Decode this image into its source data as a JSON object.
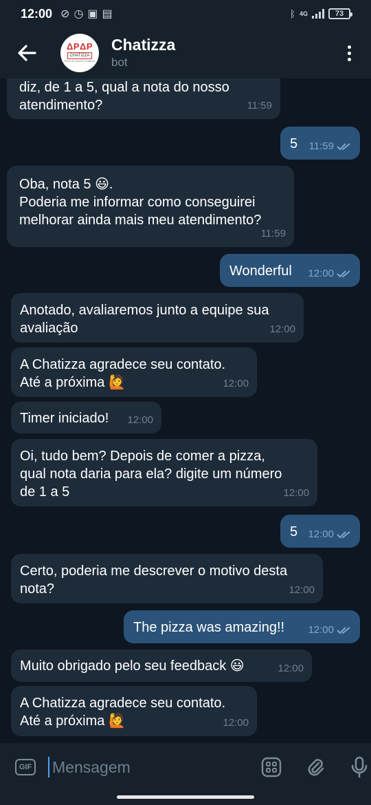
{
  "status_bar": {
    "time": "12:00",
    "network": "4G",
    "battery": "73"
  },
  "header": {
    "title": "Chatizza",
    "subtitle": "bot",
    "avatar_logo_top": "ΔPΔP",
    "avatar_logo_name": "CHATIZZA",
    "avatar_logo_sub": "Pizza & Lanche Chatizza"
  },
  "messages": [
    {
      "dir": "in",
      "text": "diz, de 1 a 5, qual a nota do nosso\natendimento?",
      "time": "11:59"
    },
    {
      "dir": "out",
      "text": "5",
      "time": "11:59"
    },
    {
      "dir": "in",
      "text": "Oba, nota 5 😃.\nPoderia me informar como conseguirei\nmelhorar ainda mais meu atendimento?",
      "time": "11:59"
    },
    {
      "dir": "out",
      "text": "Wonderful",
      "time": "12:00"
    },
    {
      "dir": "in",
      "text": "Anotado, avaliaremos junto a equipe sua\navaliação",
      "time": "12:00"
    },
    {
      "dir": "in",
      "text": "A Chatizza agradece seu contato.\nAté a próxima 🙋",
      "time": "12:00"
    },
    {
      "dir": "in",
      "text": "Timer iniciado!",
      "time": "12:00"
    },
    {
      "dir": "in",
      "text": "Oi, tudo bem? Depois de comer a pizza,\nqual nota daria para ela? digite um número\nde 1 a 5",
      "time": "12:00"
    },
    {
      "dir": "out",
      "text": "5",
      "time": "12:00"
    },
    {
      "dir": "in",
      "text": "Certo, poderia me descrever o motivo desta\nnota?",
      "time": "12:00"
    },
    {
      "dir": "out",
      "text": "The pizza was amazing!!",
      "time": "12:00"
    },
    {
      "dir": "in",
      "text": "Muito obrigado pelo seu feedback 😃",
      "time": "12:00"
    },
    {
      "dir": "in",
      "text": "A Chatizza agradece seu contato.\nAté a próxima 🙋",
      "time": "12:00"
    }
  ],
  "input": {
    "placeholder": "Mensagem",
    "gif_label": "GIF"
  }
}
